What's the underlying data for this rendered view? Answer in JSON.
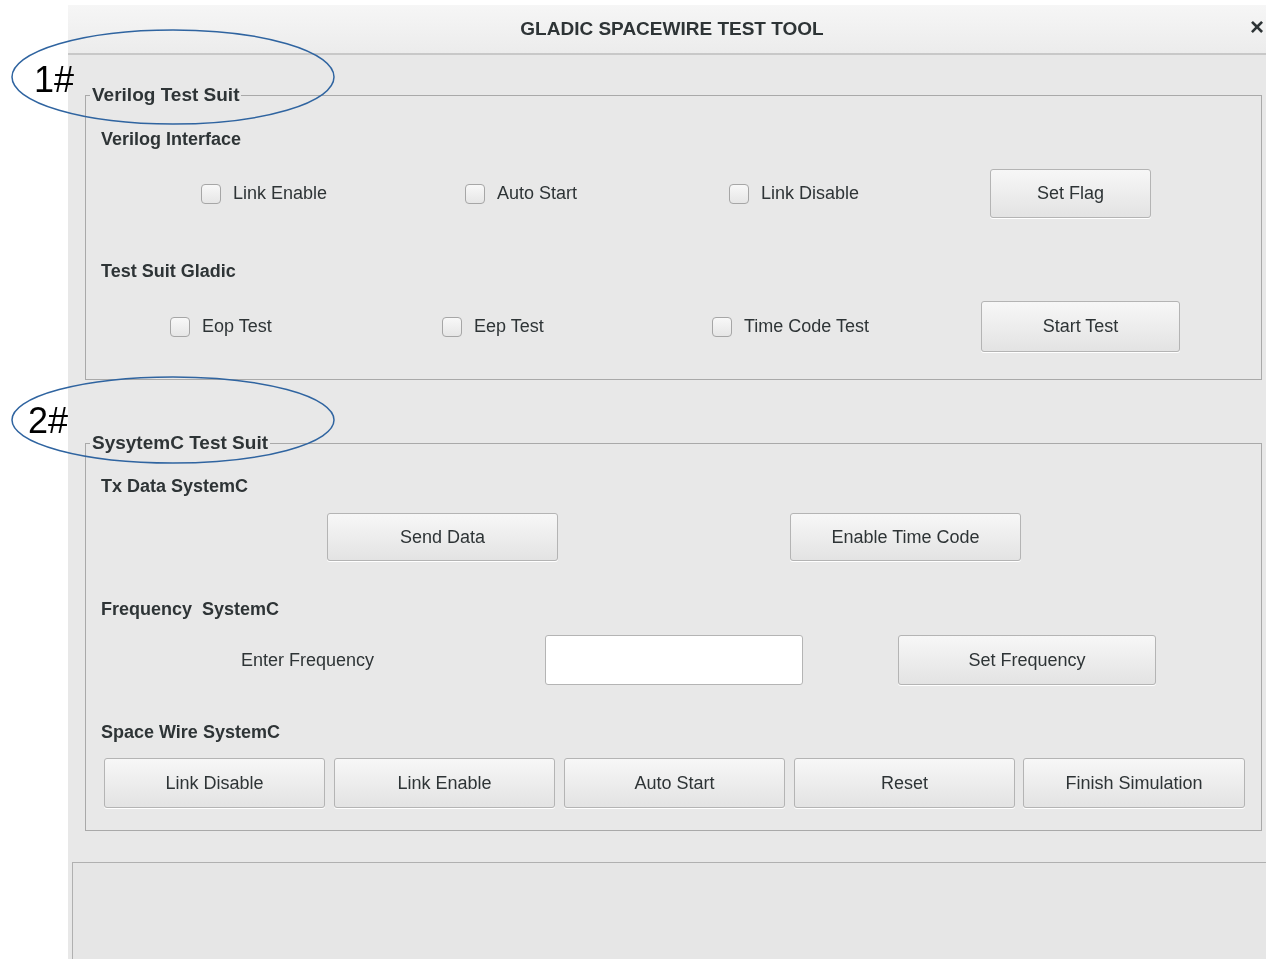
{
  "window": {
    "title": "GLADIC SPACEWIRE TEST TOOL",
    "close": "×"
  },
  "sections": [
    {
      "legend": "Verilog Test Suit",
      "annotation": "1#",
      "groups": [
        {
          "heading": "Verilog Interface",
          "items": [
            {
              "kind": "checkbox",
              "label": "Link Enable",
              "checked": false
            },
            {
              "kind": "checkbox",
              "label": "Auto Start",
              "checked": false
            },
            {
              "kind": "checkbox",
              "label": "Link Disable",
              "checked": false
            },
            {
              "kind": "button",
              "label": "Set Flag"
            }
          ]
        },
        {
          "heading": "Test Suit Gladic",
          "items": [
            {
              "kind": "checkbox",
              "label": "Eop Test",
              "checked": false
            },
            {
              "kind": "checkbox",
              "label": "Eep Test",
              "checked": false
            },
            {
              "kind": "checkbox",
              "label": "Time Code Test",
              "checked": false
            },
            {
              "kind": "button",
              "label": "Start Test"
            }
          ]
        }
      ]
    },
    {
      "legend": "SysytemC Test Suit",
      "annotation": "2#",
      "groups": [
        {
          "heading": "Tx Data SystemC",
          "items": [
            {
              "kind": "button",
              "label": "Send Data"
            },
            {
              "kind": "button",
              "label": "Enable Time Code"
            }
          ]
        },
        {
          "heading": "Frequency  SystemC",
          "items": [
            {
              "kind": "label",
              "label": "Enter Frequency"
            },
            {
              "kind": "input"
            },
            {
              "kind": "button",
              "label": "Set Frequency"
            }
          ]
        },
        {
          "heading": "Space Wire SystemC",
          "items": [
            {
              "kind": "button",
              "label": "Link Disable"
            },
            {
              "kind": "button",
              "label": "Link Enable"
            },
            {
              "kind": "button",
              "label": "Auto Start"
            },
            {
              "kind": "button",
              "label": "Reset"
            },
            {
              "kind": "button",
              "label": "Finish Simulation"
            }
          ]
        }
      ]
    }
  ]
}
